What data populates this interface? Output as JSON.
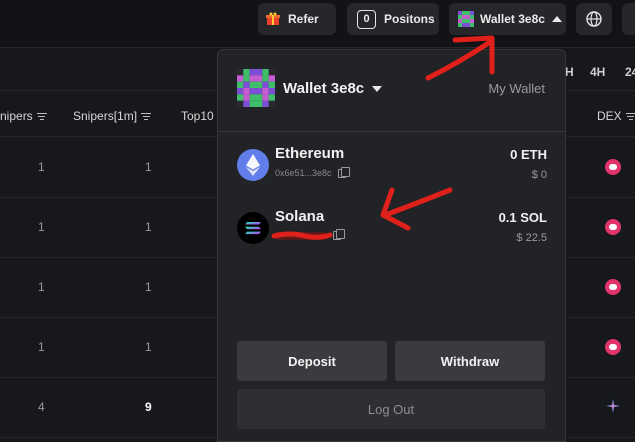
{
  "topbar": {
    "refer_label": "Refer",
    "positions_count": "0",
    "positions_label": "Positons",
    "wallet_label": "Wallet 3e8c"
  },
  "timeframes": [
    "H",
    "4H",
    "24"
  ],
  "table": {
    "headers": {
      "snipers": "nipers",
      "snipers_1m": "Snipers[1m]",
      "top10": "Top10",
      "dex": "DEX"
    },
    "rows": [
      {
        "snipers": "1",
        "snipers_1m": "1"
      },
      {
        "snipers": "1",
        "snipers_1m": "1"
      },
      {
        "snipers": "1",
        "snipers_1m": "1"
      },
      {
        "snipers": "1",
        "snipers_1m": "1"
      },
      {
        "snipers": "4",
        "snipers_1m": "9"
      }
    ]
  },
  "wallet_panel": {
    "wallet_name": "Wallet 3e8c",
    "my_wallet_label": "My Wallet",
    "chains": [
      {
        "name": "Ethereum",
        "address": "0x6e51...3e8c",
        "balance": "0 ETH",
        "usd": "$ 0",
        "logo": "ethereum-icon"
      },
      {
        "name": "Solana",
        "address": "",
        "balance": "0.1 SOL",
        "usd": "$ 22.5",
        "logo": "solana-icon"
      }
    ],
    "deposit_label": "Deposit",
    "withdraw_label": "Withdraw",
    "logout_label": "Log Out"
  },
  "colors": {
    "background": "#17181b",
    "panel": "#222326",
    "annotation": "#e0201a",
    "dex_pink": "#e2336b"
  }
}
